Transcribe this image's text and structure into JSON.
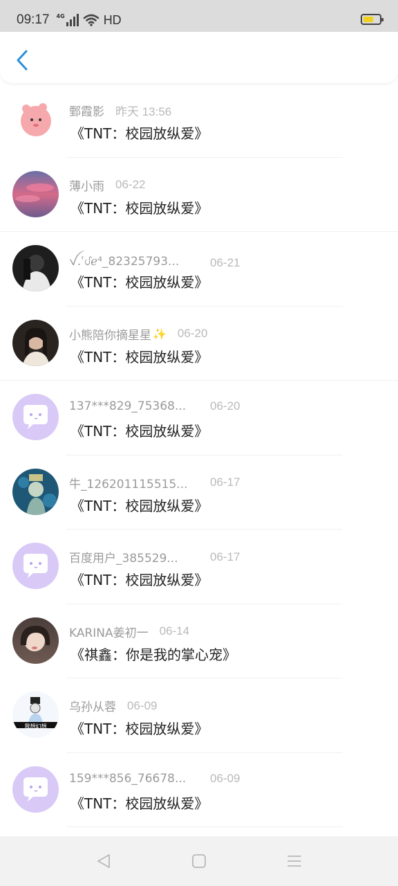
{
  "status_bar": {
    "time": "09:17",
    "network": "4G",
    "hd": "HD",
    "battery_level": 0.62,
    "battery_color": "#f0d21e"
  },
  "header": {
    "back_icon": "chevron-left-icon",
    "accent": "#2c8fd6"
  },
  "messages": [
    {
      "name": "鄄霞影",
      "date": "昨天 13:56",
      "title": "《TNT：校园放纵爱》",
      "avatar": "pink-cartoon-avatar"
    },
    {
      "name": "薄小雨",
      "date": "06-22",
      "title": "《TNT：校园放纵爱》",
      "avatar": "pink-sky-photo-avatar"
    },
    {
      "name": "ꪜ.ʿᦔℯ⁴_82325793...",
      "date": "06-21",
      "title": "《TNT：校园放纵爱》",
      "avatar": "girl-photo-avatar"
    },
    {
      "name": "小熊陪你摘星星",
      "date": "06-20",
      "title": "《TNT：校园放纵爱》",
      "avatar": "girl-portrait-avatar",
      "sparkle": "✨"
    },
    {
      "name": "137***829_75368...",
      "date": "06-20",
      "title": "《TNT：校园放纵爱》",
      "avatar": "default-chat-avatar"
    },
    {
      "name": "牛_126201115515...",
      "date": "06-17",
      "title": "《TNT：校园放纵爱》",
      "avatar": "anime-character-avatar"
    },
    {
      "name": "百度用户_385529...",
      "date": "06-17",
      "title": "《TNT：校园放纵爱》",
      "avatar": "default-chat-avatar"
    },
    {
      "name": "KARINA姜初一",
      "date": "06-14",
      "title": "《祺鑫：你是我的掌心宠》",
      "avatar": "idol-photo-avatar"
    },
    {
      "name": "乌孙从蓉",
      "date": "06-09",
      "title": "《TNT：校园放纵爱》",
      "avatar": "boy-sketch-avatar",
      "avatar_caption": "我想幻想"
    },
    {
      "name": "159***856_76678...",
      "date": "06-09",
      "title": "《TNT：校园放纵爱》",
      "avatar": "default-chat-avatar"
    }
  ],
  "nav": {
    "back": "triangle-back-icon",
    "home": "square-home-icon",
    "menu": "menu-lines-icon"
  }
}
